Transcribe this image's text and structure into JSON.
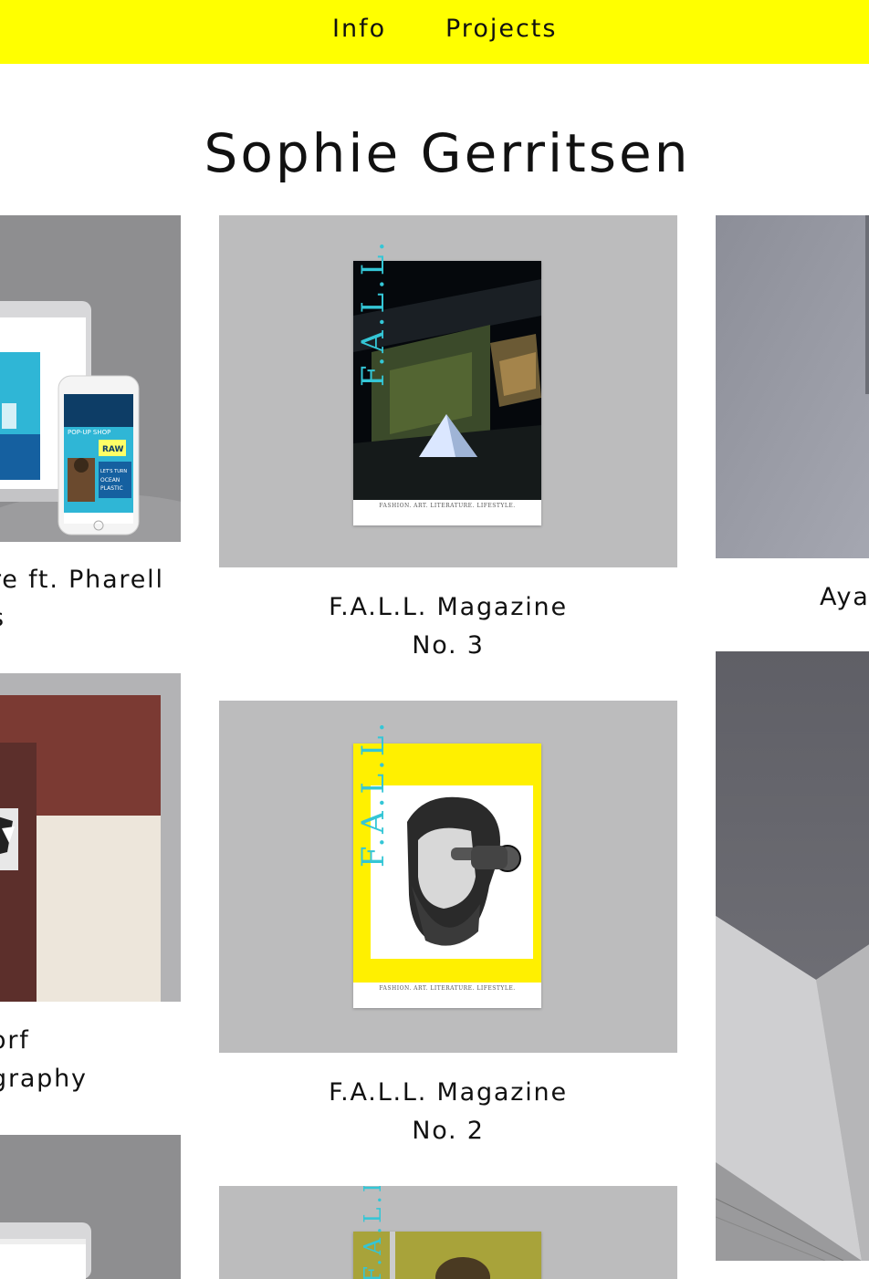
{
  "nav": {
    "info": "Info",
    "projects": "Projects"
  },
  "site": {
    "title": "Sophie Gerritsen"
  },
  "cards": {
    "c1_1": {
      "caption_lines": [
        "re ft. Pharell",
        "s"
      ],
      "popup_shop": "POP-UP SHOP",
      "raw": "RAW",
      "ocean": "LET'S TURN OCEAN PLASTIC FANTASTIC"
    },
    "c1_2": {
      "caption_lines": [
        "orf",
        "graphy"
      ]
    },
    "c2_1": {
      "caption_lines": [
        "F.A.L.L. Magazine",
        "No. 3"
      ],
      "logo": "F.A.L.L.",
      "tagline": "FASHION. ART. LITERATURE. LIFESTYLE."
    },
    "c2_2": {
      "caption_lines": [
        "F.A.L.L. Magazine",
        "No. 2"
      ],
      "logo": "F.A.L.L.",
      "tagline": "FASHION. ART. LITERATURE. LIFESTYLE."
    },
    "c2_3": {
      "logo": "F.A.L.L."
    },
    "c3_1": {
      "caption_lines": [
        "Aya"
      ]
    }
  },
  "colors": {
    "nav_bg": "#ffff00",
    "card_bg": "#bcbcbd",
    "accent_cyan": "#34c6d6"
  }
}
